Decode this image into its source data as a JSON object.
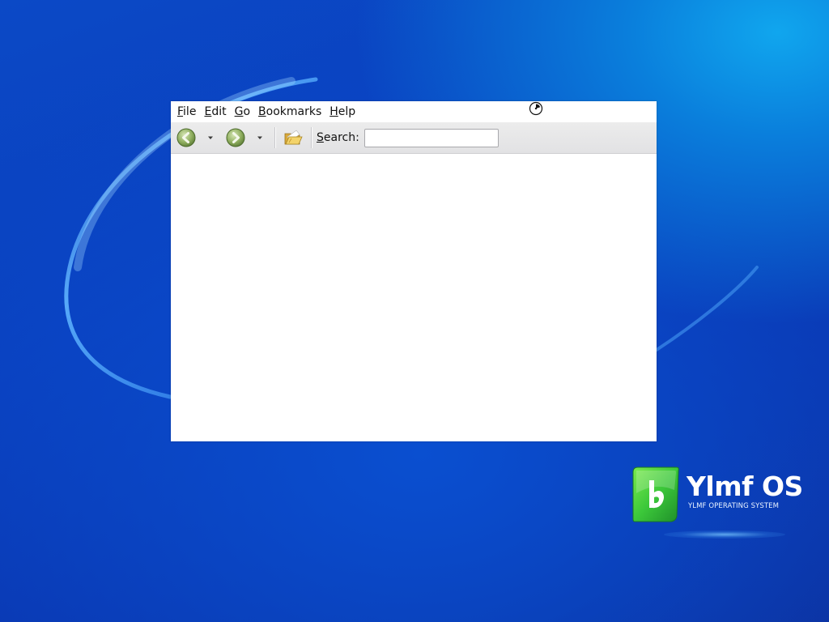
{
  "desktop": {
    "background_colors": [
      "#0b49c6",
      "#10a6ee",
      "#0c2f9c"
    ]
  },
  "window": {
    "menubar": {
      "items": [
        "File",
        "Edit",
        "Go",
        "Bookmarks",
        "Help"
      ]
    },
    "toolbar": {
      "back_icon": "back-arrow-icon",
      "forward_icon": "forward-arrow-icon",
      "history_dropdown_icon": "chevron-down-icon",
      "open_location_icon": "folder-icon",
      "search_label": "Search:",
      "search_value": ""
    }
  },
  "logo": {
    "title": "Ylmf OS",
    "subtitle": "YLMF OPERATING SYSTEM",
    "brand_color": "#3cc83a"
  },
  "cursor": {
    "icon": "busy-cursor-icon"
  }
}
